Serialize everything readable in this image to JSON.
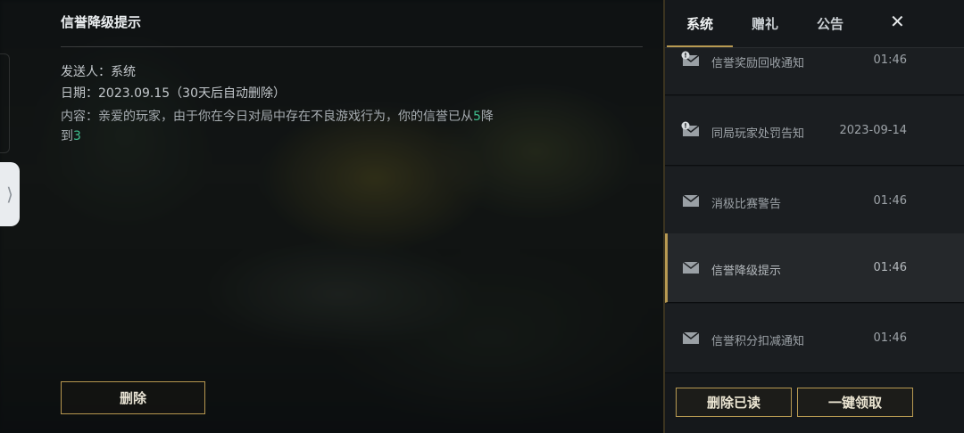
{
  "detail": {
    "title": "信誉降级提示",
    "sender_label": "发送人：",
    "sender": "系统",
    "date_label": "日期：",
    "date": "2023.09.15",
    "date_note": "（30天后自动删除）",
    "content_label": "内容：",
    "content_pre": "亲爱的玩家，由于你在今日对局中存在不良游戏行为，你的信誉已从",
    "from_level": "5",
    "content_mid": "降到",
    "to_level": "3",
    "delete_label": "删除"
  },
  "tabs": [
    {
      "label": "系统",
      "active": true
    },
    {
      "label": "赠礼",
      "active": false
    },
    {
      "label": "公告",
      "active": false
    }
  ],
  "close_symbol": "✕",
  "edge_handle_symbol": "⟩",
  "mails": [
    {
      "subject": "信誉奖励回收通知",
      "time": "01:46",
      "icon": "mail-alert-icon"
    },
    {
      "subject": "同局玩家处罚告知",
      "time": "2023-09-14",
      "icon": "mail-alert-icon"
    },
    {
      "subject": "消极比赛警告",
      "time": "01:46",
      "icon": "mail-icon"
    },
    {
      "subject": "信誉降级提示",
      "time": "01:46",
      "icon": "mail-icon",
      "selected": true
    },
    {
      "subject": "信誉积分扣减通知",
      "time": "01:46",
      "icon": "mail-icon"
    }
  ],
  "footer": {
    "delete_read_label": "删除已读",
    "claim_all_label": "一键领取"
  },
  "colors": {
    "accent_gold": "#b89a52",
    "highlight_green": "#3fbf8f"
  }
}
